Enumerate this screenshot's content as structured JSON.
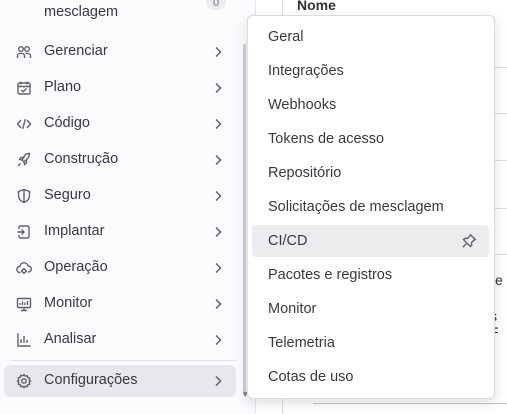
{
  "sidebar": {
    "top_item": {
      "label": "mesclagem",
      "badge": "0"
    },
    "items": [
      {
        "label": "Gerenciar",
        "icon": "users-icon"
      },
      {
        "label": "Plano",
        "icon": "calendar-icon"
      },
      {
        "label": "Código",
        "icon": "code-icon"
      },
      {
        "label": "Construção",
        "icon": "rocket-icon"
      },
      {
        "label": "Seguro",
        "icon": "shield-icon"
      },
      {
        "label": "Implantar",
        "icon": "deployments-icon"
      },
      {
        "label": "Operação",
        "icon": "cloud-gear-icon"
      },
      {
        "label": "Monitor",
        "icon": "monitor-icon"
      },
      {
        "label": "Analisar",
        "icon": "chart-icon"
      },
      {
        "label": "Configurações",
        "icon": "settings-icon",
        "active": true
      }
    ]
  },
  "main": {
    "column_header": "Nome",
    "fragments": [
      "e",
      "s F"
    ]
  },
  "flyout": {
    "items": [
      {
        "label": "Geral"
      },
      {
        "label": "Integrações"
      },
      {
        "label": "Webhooks"
      },
      {
        "label": "Tokens de acesso"
      },
      {
        "label": "Repositório"
      },
      {
        "label": "Solicitações de mesclagem"
      },
      {
        "label": "CI/CD",
        "highlighted": true,
        "pin_icon": "thumbtack-icon"
      },
      {
        "label": "Pacotes e registros"
      },
      {
        "label": "Monitor"
      },
      {
        "label": "Telemetria"
      },
      {
        "label": "Cotas de uso"
      }
    ]
  },
  "colors": {
    "sidebar_bg": "#fbfafd",
    "active_bg": "#e8e7ed",
    "highlight_bg": "#ececef",
    "text": "#3a383f",
    "icon": "#626168"
  }
}
